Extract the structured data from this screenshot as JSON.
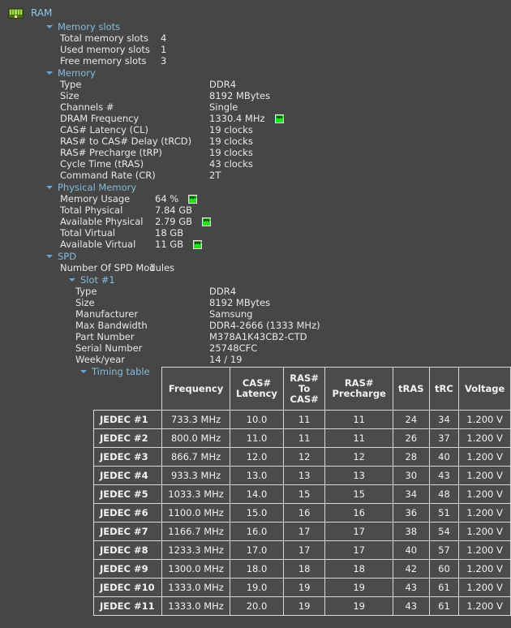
{
  "root": {
    "label": "RAM",
    "icon": "ram-module-icon"
  },
  "sections": [
    {
      "title": "Memory slots",
      "rows": [
        {
          "label": "Total memory slots",
          "value": "4"
        },
        {
          "label": "Used memory slots",
          "value": "1"
        },
        {
          "label": "Free memory slots",
          "value": "3"
        }
      ]
    },
    {
      "title": "Memory",
      "rows": [
        {
          "label": "Type",
          "value": "DDR4"
        },
        {
          "label": "Size",
          "value": "8192 MBytes"
        },
        {
          "label": "Channels #",
          "value": "Single"
        },
        {
          "label": "DRAM Frequency",
          "value": "1330.4 MHz",
          "led": true
        },
        {
          "label": "CAS# Latency (CL)",
          "value": "19 clocks"
        },
        {
          "label": "RAS# to CAS# Delay (tRCD)",
          "value": "19 clocks"
        },
        {
          "label": "RAS# Precharge (tRP)",
          "value": "19 clocks"
        },
        {
          "label": "Cycle Time (tRAS)",
          "value": "43 clocks"
        },
        {
          "label": "Command Rate (CR)",
          "value": "2T"
        }
      ]
    },
    {
      "title": "Physical Memory",
      "rows": [
        {
          "label": "Memory Usage",
          "value": "64 %",
          "led": true
        },
        {
          "label": "Total Physical",
          "value": "7.84 GB"
        },
        {
          "label": "Available Physical",
          "value": "2.79 GB",
          "led": true
        },
        {
          "label": "Total Virtual",
          "value": "18 GB"
        },
        {
          "label": "Available Virtual",
          "value": "11 GB",
          "led": true
        }
      ]
    },
    {
      "title": "SPD",
      "rows": [
        {
          "label": "Number Of SPD Modules",
          "value": "1"
        }
      ]
    }
  ],
  "slot": {
    "title": "Slot #1",
    "rows": [
      {
        "label": "Type",
        "value": "DDR4"
      },
      {
        "label": "Size",
        "value": "8192 MBytes"
      },
      {
        "label": "Manufacturer",
        "value": "Samsung"
      },
      {
        "label": "Max Bandwidth",
        "value": "DDR4-2666 (1333 MHz)"
      },
      {
        "label": "Part Number",
        "value": "M378A1K43CB2-CTD"
      },
      {
        "label": "Serial Number",
        "value": "25748CFC"
      },
      {
        "label": "Week/year",
        "value": "14 / 19"
      }
    ],
    "timing_table_label": "Timing table"
  },
  "timing_table": {
    "columns": [
      "",
      "Frequency",
      "CAS# Latency",
      "RAS# To CAS#",
      "RAS# Precharge",
      "tRAS",
      "tRC",
      "Voltage"
    ],
    "rows": [
      {
        "name": "JEDEC #1",
        "frequency": "733.3 MHz",
        "cas_latency": "10.0",
        "ras_to_cas": "11",
        "ras_precharge": "11",
        "tras": "24",
        "trc": "34",
        "voltage": "1.200 V"
      },
      {
        "name": "JEDEC #2",
        "frequency": "800.0 MHz",
        "cas_latency": "11.0",
        "ras_to_cas": "11",
        "ras_precharge": "11",
        "tras": "26",
        "trc": "37",
        "voltage": "1.200 V"
      },
      {
        "name": "JEDEC #3",
        "frequency": "866.7 MHz",
        "cas_latency": "12.0",
        "ras_to_cas": "12",
        "ras_precharge": "12",
        "tras": "28",
        "trc": "40",
        "voltage": "1.200 V"
      },
      {
        "name": "JEDEC #4",
        "frequency": "933.3 MHz",
        "cas_latency": "13.0",
        "ras_to_cas": "13",
        "ras_precharge": "13",
        "tras": "30",
        "trc": "43",
        "voltage": "1.200 V"
      },
      {
        "name": "JEDEC #5",
        "frequency": "1033.3 MHz",
        "cas_latency": "14.0",
        "ras_to_cas": "15",
        "ras_precharge": "15",
        "tras": "34",
        "trc": "48",
        "voltage": "1.200 V"
      },
      {
        "name": "JEDEC #6",
        "frequency": "1100.0 MHz",
        "cas_latency": "15.0",
        "ras_to_cas": "16",
        "ras_precharge": "16",
        "tras": "36",
        "trc": "51",
        "voltage": "1.200 V"
      },
      {
        "name": "JEDEC #7",
        "frequency": "1166.7 MHz",
        "cas_latency": "16.0",
        "ras_to_cas": "17",
        "ras_precharge": "17",
        "tras": "38",
        "trc": "54",
        "voltage": "1.200 V"
      },
      {
        "name": "JEDEC #8",
        "frequency": "1233.3 MHz",
        "cas_latency": "17.0",
        "ras_to_cas": "17",
        "ras_precharge": "17",
        "tras": "40",
        "trc": "57",
        "voltage": "1.200 V"
      },
      {
        "name": "JEDEC #9",
        "frequency": "1300.0 MHz",
        "cas_latency": "18.0",
        "ras_to_cas": "18",
        "ras_precharge": "18",
        "tras": "42",
        "trc": "60",
        "voltage": "1.200 V"
      },
      {
        "name": "JEDEC #10",
        "frequency": "1333.0 MHz",
        "cas_latency": "19.0",
        "ras_to_cas": "19",
        "ras_precharge": "19",
        "tras": "43",
        "trc": "61",
        "voltage": "1.200 V"
      },
      {
        "name": "JEDEC #11",
        "frequency": "1333.0 MHz",
        "cas_latency": "20.0",
        "ras_to_cas": "19",
        "ras_precharge": "19",
        "tras": "43",
        "trc": "61",
        "voltage": "1.200 V"
      }
    ]
  },
  "colors": {
    "background": "#464646",
    "section_title": "#83bcdc",
    "text": "#e8e8e8",
    "led_green": "#22e216",
    "table_border": "#d8d8d8"
  }
}
